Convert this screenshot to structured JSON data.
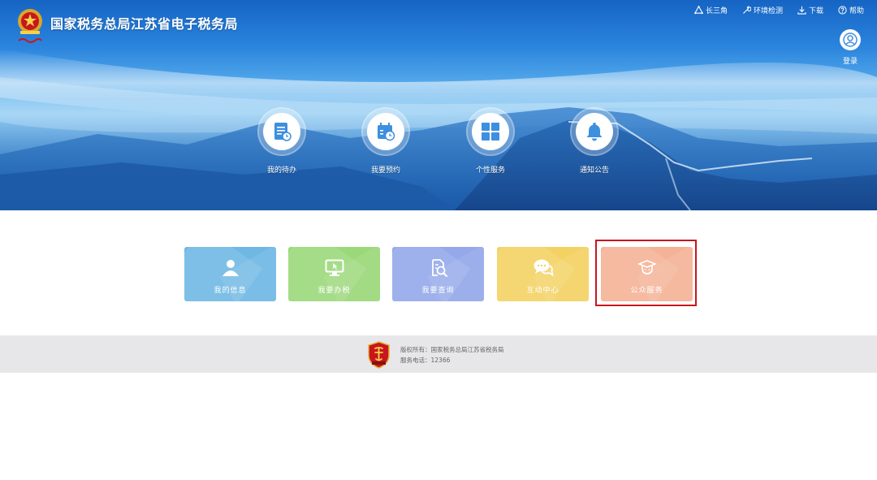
{
  "header": {
    "site_title": "国家税务总局江苏省电子税务局",
    "links": [
      {
        "label": "长三角",
        "icon": "triangle-network-icon"
      },
      {
        "label": "环境检测",
        "icon": "wrench-icon"
      },
      {
        "label": "下载",
        "icon": "download-icon"
      },
      {
        "label": "帮助",
        "icon": "help-circle-icon"
      }
    ],
    "login_label": "登录"
  },
  "quick_entries": [
    {
      "label": "我的待办",
      "icon": "todo-document-icon"
    },
    {
      "label": "我要预约",
      "icon": "calendar-clock-icon"
    },
    {
      "label": "个性服务",
      "icon": "grid-tiles-icon"
    },
    {
      "label": "通知公告",
      "icon": "bell-icon"
    }
  ],
  "tiles": [
    {
      "label": "我的信息",
      "icon": "user-icon",
      "color": "#6fb8e4"
    },
    {
      "label": "我要办税",
      "icon": "monitor-cursor-icon",
      "color": "#9bd87a"
    },
    {
      "label": "我要查询",
      "icon": "document-search-icon",
      "color": "#95a9ea"
    },
    {
      "label": "互动中心",
      "icon": "chat-bubbles-icon",
      "color": "#f3d263"
    },
    {
      "label": "公众服务",
      "icon": "graduate-hat-icon",
      "color": "#f4b396"
    }
  ],
  "footer": {
    "copyright": "版权所有：国家税务总局江苏省税务局",
    "phone": "服务电话：12366"
  },
  "colors": {
    "highlight_border": "#c8161d",
    "footer_bg": "#e7e7e9",
    "hero_blue": "#2a84dd"
  }
}
